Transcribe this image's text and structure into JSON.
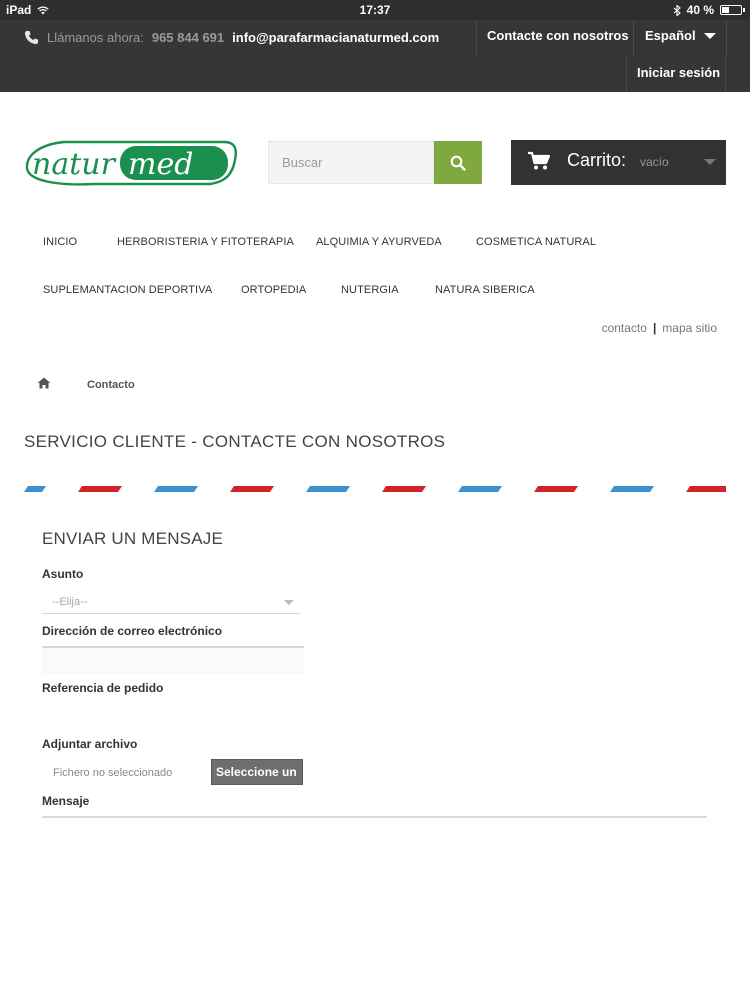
{
  "status_bar": {
    "device": "iPad",
    "time": "17:37",
    "battery": "40 %",
    "battery_level": 0.4
  },
  "top_bar": {
    "call_label": "Llámanos ahora:",
    "phone": "965 844 691",
    "email": "info@parafarmacianaturmed.com",
    "contact_link": "Contacte con nosotros",
    "language": "Español",
    "login": "Iniciar sesión"
  },
  "header": {
    "logo_text_left": "natur",
    "logo_text_right": "med",
    "search_placeholder": "Buscar",
    "cart_label": "Carrito:",
    "cart_status": "vacío"
  },
  "menu": {
    "items": [
      "INICIO",
      "HERBORISTERIA Y FITOTERAPIA",
      "ALQUIMIA Y AYURVEDA",
      "COSMETICA NATURAL",
      "SUPLEMANTACION DEPORTIVA",
      "ORTOPEDIA",
      "NUTERGIA",
      "NATURA SIBERICA"
    ]
  },
  "util_links": {
    "contact": "contacto",
    "sitemap": "mapa sitio"
  },
  "breadcrumb": {
    "current": "Contacto"
  },
  "page": {
    "title": "SERVICIO CLIENTE - CONTACTE CON NOSOTROS"
  },
  "form": {
    "heading": "ENVIAR UN MENSAJE",
    "subject_label": "Asunto",
    "subject_value": "--Elija--",
    "email_label": "Dirección de correo electrónico",
    "order_label": "Referencia de pedido",
    "attach_label": "Adjuntar archivo",
    "file_status": "Fichero no seleccionado",
    "file_button": "Seleccione un",
    "message_label": "Mensaje"
  },
  "colors": {
    "accent_green": "#7fa83f",
    "dark_bar": "#363636",
    "stripe_red": "#d0232a",
    "stripe_blue": "#3d8fcd"
  }
}
